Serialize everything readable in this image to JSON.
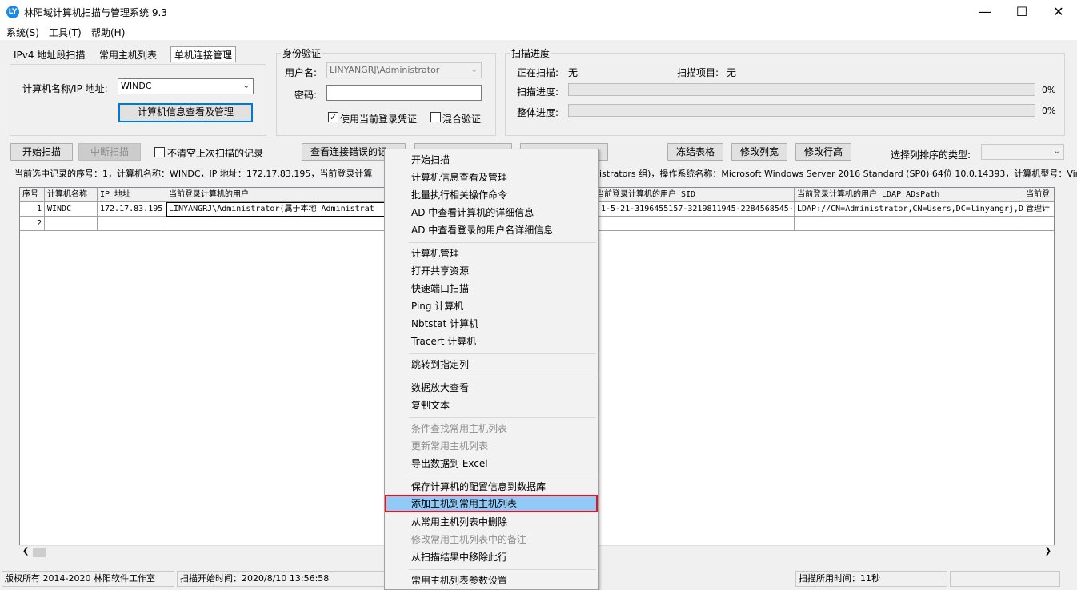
{
  "window": {
    "title": "林阳域计算机扫描与管理系统 9.3",
    "icon_text": "LY",
    "minimize": "—",
    "maximize": "☐",
    "close": "✕"
  },
  "menu": [
    "系统(S)",
    "工具(T)",
    "帮助(H)"
  ],
  "tabs": [
    "IPv4 地址段扫描",
    "常用主机列表",
    "单机连接管理"
  ],
  "host_panel": {
    "label": "计算机名称/IP 地址:",
    "value": "WINDC",
    "button": "计算机信息查看及管理"
  },
  "auth": {
    "title": "身份验证",
    "username_label": "用户名:",
    "username_value": "LINYANGRJ\\Administrator",
    "password_label": "密码:",
    "password_value": "",
    "use_current_label": "使用当前登录凭证",
    "use_current_checked": "✓",
    "mixed_label": "混合验证"
  },
  "progress": {
    "title": "扫描进度",
    "scanning_label": "正在扫描:",
    "scanning_value": "无",
    "item_label": "扫描项目:",
    "item_value": "无",
    "scan_progress_label": "扫描进度:",
    "scan_progress_pct": "0%",
    "overall_label": "整体进度:",
    "overall_pct": "0%"
  },
  "toolbar": {
    "start": "开始扫描",
    "stop": "中断扫描",
    "keep_label": "不清空上次扫描的记录",
    "view_errors": "查看连接错误的记",
    "freeze": "冻结表格",
    "col_width": "修改列宽",
    "row_height": "修改行高",
    "sort_label": "选择列排序的类型:",
    "sort_value": ""
  },
  "info_line_left": "当前选中记录的序号：1，计算机名称：WINDC，IP 地址：172.17.83.195，当前登录计算",
  "info_line_right": "nistrators 组)，操作系统名称：Microsoft Windows Server 2016 Standard (SP0) 64位 10.0.14393，计算机型号：Virtual M",
  "table": {
    "headers": [
      "序号",
      "计算机名称",
      "IP 地址",
      "当前登录计算机的用户",
      "",
      "当前登录计算机的用户 SID",
      "当前登录计算机的用户 LDAP ADsPath",
      "当前登"
    ],
    "rows": [
      [
        "1",
        "WINDC",
        "172.17.83.195",
        "LINYANGRJ\\Administrator(属于本地 Administrat",
        "",
        "-1-5-21-3196455157-3219811945-2284568545-",
        "LDAP://CN=Administrator,CN=Users,DC=linyangrj,D",
        "管理计"
      ],
      [
        "2",
        "",
        "",
        "",
        "",
        "",
        "",
        ""
      ]
    ]
  },
  "context_menu": {
    "items": [
      {
        "label": "开始扫描",
        "state": "normal"
      },
      {
        "label": "计算机信息查看及管理",
        "state": "normal"
      },
      {
        "label": "批量执行相关操作命令",
        "state": "normal"
      },
      {
        "label": "AD 中查看计算机的详细信息",
        "state": "normal"
      },
      {
        "label": "AD 中查看登录的用户名详细信息",
        "state": "normal"
      },
      {
        "label": "计算机管理",
        "state": "normal"
      },
      {
        "label": "打开共享资源",
        "state": "normal"
      },
      {
        "label": "快速端口扫描",
        "state": "normal"
      },
      {
        "label": "Ping 计算机",
        "state": "normal"
      },
      {
        "label": "Nbtstat 计算机",
        "state": "normal"
      },
      {
        "label": "Tracert 计算机",
        "state": "normal"
      },
      {
        "label": "跳转到指定列",
        "state": "normal"
      },
      {
        "label": "数据放大查看",
        "state": "normal"
      },
      {
        "label": "复制文本",
        "state": "normal"
      },
      {
        "label": "条件查找常用主机列表",
        "state": "disabled"
      },
      {
        "label": "更新常用主机列表",
        "state": "disabled"
      },
      {
        "label": "导出数据到 Excel",
        "state": "normal"
      },
      {
        "label": "保存计算机的配置信息到数据库",
        "state": "normal"
      },
      {
        "label": "添加主机到常用主机列表",
        "state": "selected"
      },
      {
        "label": "从常用主机列表中删除",
        "state": "normal"
      },
      {
        "label": "修改常用主机列表中的备注",
        "state": "disabled"
      },
      {
        "label": "从扫描结果中移除此行",
        "state": "normal"
      },
      {
        "label": "常用主机列表参数设置",
        "state": "normal"
      }
    ]
  },
  "statusbar": {
    "copyright": "版权所有 2014-2020 林阳软件工作室",
    "start_time": "扫描开始时间：2020/8/10 13:56:58",
    "elapsed": "扫描所用时间：11秒"
  }
}
